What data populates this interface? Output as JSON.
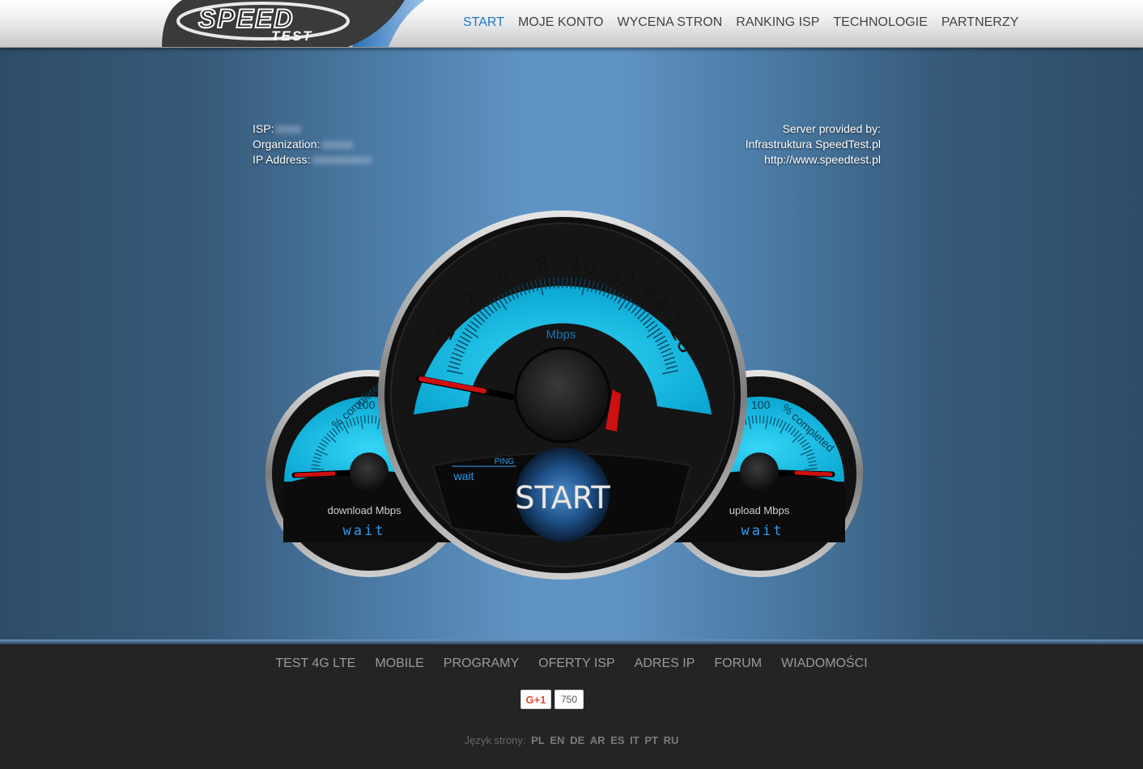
{
  "header": {
    "logo_text": "SPEED",
    "logo_subtext": "TEST",
    "nav": [
      "START",
      "MOJE KONTO",
      "WYCENA STRON",
      "RANKING ISP",
      "TECHNOLOGIE",
      "PARTNERZY"
    ],
    "active_nav": "START"
  },
  "client_info": {
    "isp_label": "ISP:",
    "organization_label": "Organization:",
    "ip_label": "IP Address:"
  },
  "server_info": {
    "line1": "Server provided by:",
    "line2": "Infrastruktura SpeedTest.pl",
    "line3": "http://www.speedtest.pl"
  },
  "main_gauge": {
    "scale_labels": [
      "1",
      "2",
      "4",
      "8",
      "16",
      "32",
      "64",
      "128"
    ],
    "unit": "Mbps",
    "ping_label": "PING",
    "ping_value": "wait",
    "start_label": "START"
  },
  "download_gauge": {
    "arc_label": "% completed",
    "max_label": "100",
    "unit_label": "download Mbps",
    "value": "wait"
  },
  "upload_gauge": {
    "arc_label": "% completed",
    "max_label": "100",
    "unit_label": "upload Mbps",
    "value": "wait"
  },
  "footer": {
    "nav": [
      "TEST 4G LTE",
      "MOBILE",
      "PROGRAMY",
      "OFERTY ISP",
      "ADRES IP",
      "FORUM",
      "WIADOMOŚCI"
    ],
    "gplus_label": "G+1",
    "gplus_count": "750",
    "language_label": "Język strony:",
    "languages": [
      "PL",
      "EN",
      "DE",
      "AR",
      "ES",
      "IT",
      "PT",
      "RU"
    ]
  },
  "colors": {
    "accent": "#1e78c8",
    "gauge_face": "#1ec8ec",
    "needle": "#d01010",
    "digital_text": "#2a9cf0"
  }
}
